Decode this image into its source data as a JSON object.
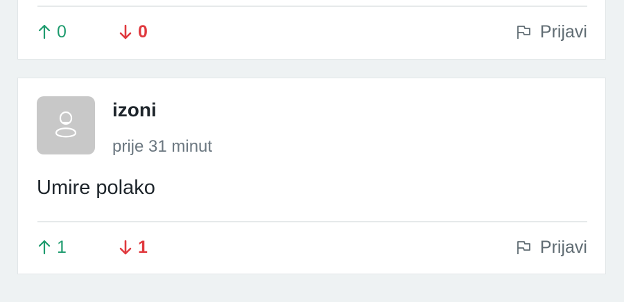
{
  "colors": {
    "upvote": "#1e9b6e",
    "downvote": "#e0393e",
    "muted": "#5f6b72",
    "background": "#eef2f3"
  },
  "comments": [
    {
      "upvotes": "0",
      "downvotes": "0",
      "report_label": "Prijavi"
    },
    {
      "author": "izoni",
      "time": "prije 31 minut",
      "text": "Umire polako",
      "avatar_icon": "user-icon",
      "upvotes": "1",
      "downvotes": "1",
      "report_label": "Prijavi"
    }
  ]
}
